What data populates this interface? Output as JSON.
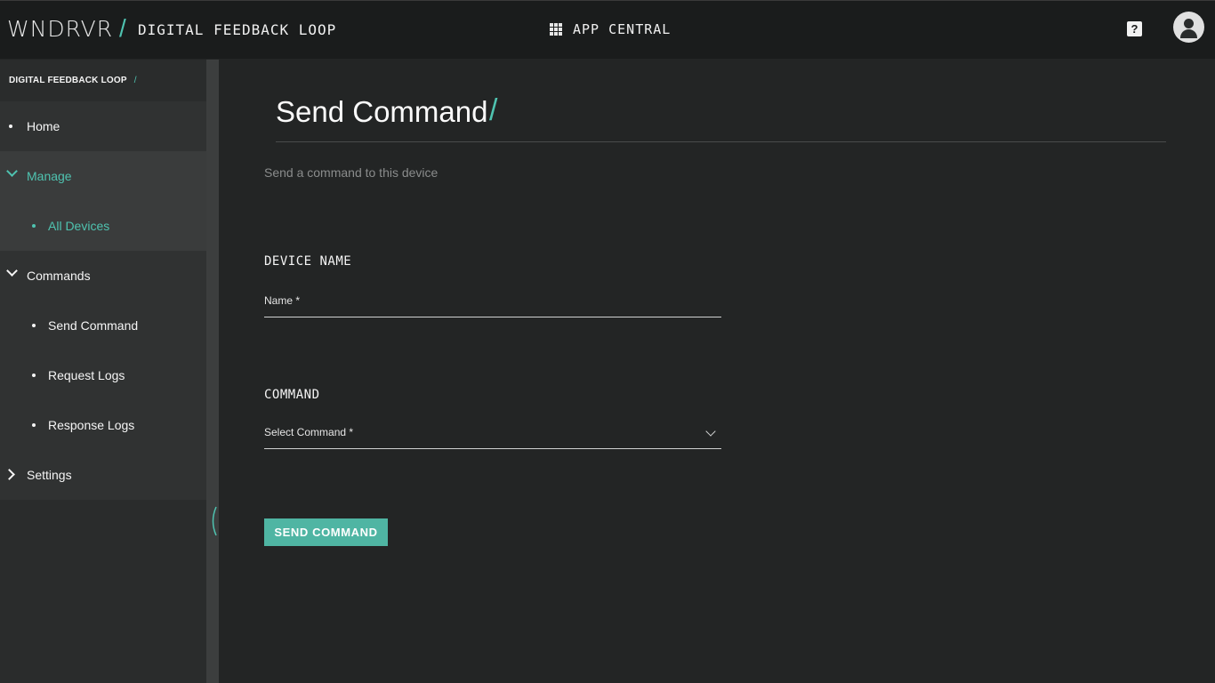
{
  "header": {
    "brand": "WNDRVR",
    "app_name": "DIGITAL FEEDBACK LOOP",
    "app_central_label": "APP CENTRAL",
    "help_glyph": "?",
    "icons": {
      "apps": "grid-icon",
      "help": "help-icon",
      "user": "user-avatar-icon"
    }
  },
  "sidebar": {
    "breadcrumb": "DIGITAL FEEDBACK LOOP",
    "items": [
      {
        "label": "Home"
      },
      {
        "label": "Manage"
      },
      {
        "label": "All Devices"
      },
      {
        "label": "Commands"
      },
      {
        "label": "Send Command"
      },
      {
        "label": "Request Logs"
      },
      {
        "label": "Response Logs"
      },
      {
        "label": "Settings"
      }
    ]
  },
  "main": {
    "title": "Send Command",
    "subtitle": "Send a command to this device",
    "device_section": "DEVICE NAME",
    "name_label": "Name *",
    "command_section": "COMMAND",
    "command_label": "Select Command *",
    "send_button": "SEND COMMAND"
  },
  "colors": {
    "accent": "#4fc3b0",
    "background": "#232525",
    "sidebar": "#2a2c2c"
  }
}
